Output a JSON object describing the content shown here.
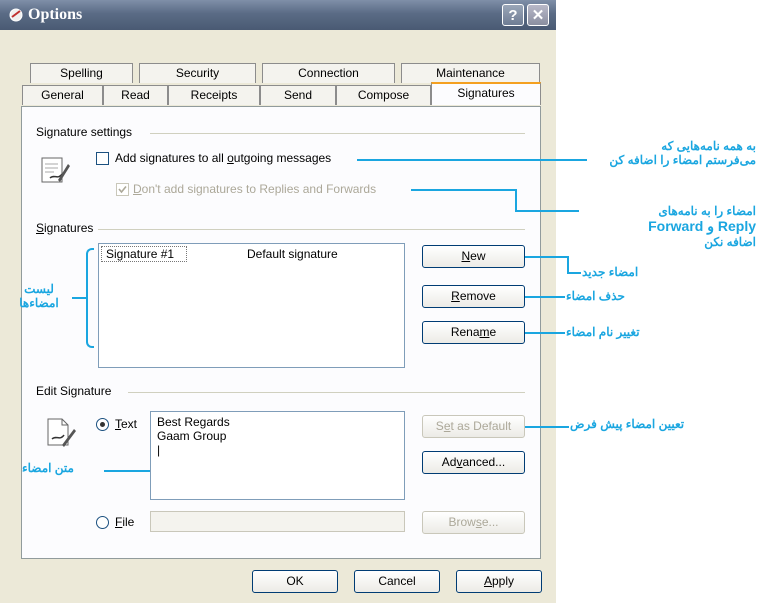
{
  "window": {
    "title": "Options",
    "help_glyph": "?",
    "close_glyph": "✕"
  },
  "tabs": {
    "row_top": [
      "Spelling",
      "Security",
      "Connection",
      "Maintenance"
    ],
    "row_bottom": [
      "General",
      "Read",
      "Receipts",
      "Send",
      "Compose",
      "Signatures"
    ],
    "active": "Signatures"
  },
  "signature_settings": {
    "group_title": "Signature settings",
    "add_to_all": {
      "pre": "Add signatures to all ",
      "key": "o",
      "post": "utgoing messages",
      "checked": false
    },
    "dont_add_replies": {
      "key": "D",
      "post": "on't add signatures to Replies and Forwards",
      "checked": true,
      "enabled": false
    }
  },
  "signatures": {
    "group_title_key": "S",
    "group_title_rest": "ignatures",
    "items": [
      {
        "name": "Signature #1",
        "note": "Default signature"
      }
    ],
    "buttons": {
      "new": {
        "key": "N",
        "rest": "ew"
      },
      "remove": {
        "key": "R",
        "rest": "emove"
      },
      "rename": {
        "pre": "Rena",
        "key": "m",
        "post": "e"
      }
    }
  },
  "edit_signature": {
    "group_title": "Edit Signature",
    "text_option": {
      "key": "T",
      "rest": "ext",
      "selected": true
    },
    "file_option": {
      "key": "F",
      "rest": "ile",
      "selected": false
    },
    "text_lines": [
      "Best Regards",
      "Gaam Group",
      "|"
    ],
    "file_value": "",
    "set_default": {
      "pre": "S",
      "key": "e",
      "post": "t as Default",
      "enabled": false
    },
    "advanced": {
      "pre": "Ad",
      "key": "v",
      "post": "anced..."
    },
    "browse": {
      "pre": "Brow",
      "key": "s",
      "post": "e...",
      "enabled": false
    }
  },
  "footer": {
    "ok": "OK",
    "cancel": "Cancel",
    "apply_key": "A",
    "apply_rest": "pply"
  },
  "annotations": {
    "add_all": [
      "به همه نامه‌هایی که",
      "می‌فرستم امضاء را اضافه کن"
    ],
    "dont_add": [
      "امضاء را به نامه‌های",
      "Reply و Forward",
      "اضافه نکن"
    ],
    "new": "امضاء جدید",
    "remove": "حذف امضاء",
    "rename": "تغییر نام امضاء",
    "list": [
      "لیست",
      "امضاءها"
    ],
    "set_default": "تعیین امضاء پیش فرض",
    "text": "متن امضاء"
  },
  "colors": {
    "annotation": "#1aa6e0",
    "dialog_bg": "#ECE9D8",
    "title_bar": "#5a6b85"
  }
}
